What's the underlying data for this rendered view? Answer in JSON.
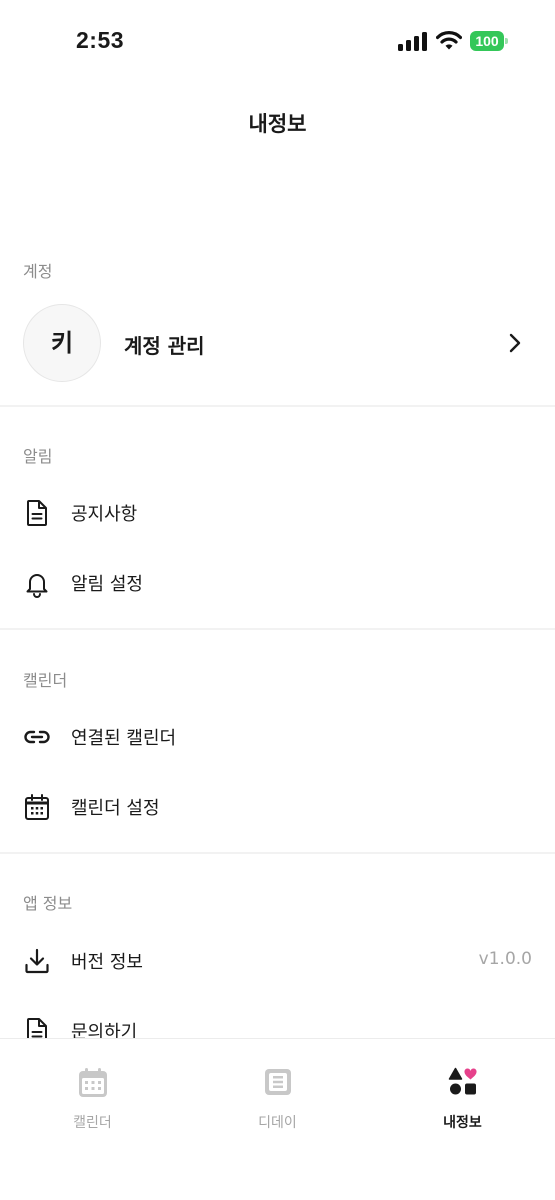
{
  "status_bar": {
    "time": "2:53",
    "battery": "100"
  },
  "header": {
    "title": "내정보"
  },
  "sections": {
    "account": {
      "title": "계정",
      "avatar_initial": "키",
      "label": "계정 관리"
    },
    "notifications": {
      "title": "알림",
      "items": [
        {
          "label": "공지사항",
          "icon": "document-icon"
        },
        {
          "label": "알림 설정",
          "icon": "bell-icon"
        }
      ]
    },
    "calendar": {
      "title": "캘린더",
      "items": [
        {
          "label": "연결된 캘린더",
          "icon": "link-icon"
        },
        {
          "label": "캘린더 설정",
          "icon": "calendar-icon"
        }
      ]
    },
    "app_info": {
      "title": "앱 정보",
      "items": [
        {
          "label": "버전 정보",
          "value": "v1.0.0",
          "icon": "download-icon"
        },
        {
          "label": "문의하기",
          "icon": "document-icon"
        }
      ]
    }
  },
  "tab_bar": {
    "tabs": [
      {
        "label": "캘린더",
        "icon": "calendar-icon",
        "active": false
      },
      {
        "label": "디데이",
        "icon": "list-icon",
        "active": false
      },
      {
        "label": "내정보",
        "icon": "shapes-heart-icon",
        "active": true
      }
    ]
  },
  "colors": {
    "accent": "#e6418b",
    "battery": "#34c759",
    "muted": "#8c8c8c",
    "tab_inactive": "#c8c8c8"
  }
}
